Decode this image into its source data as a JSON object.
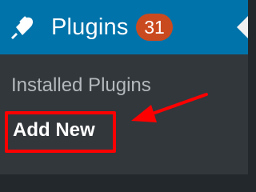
{
  "menu": {
    "icon": "plug-icon",
    "title": "Plugins",
    "badge": "31",
    "current_indicator": "current-menu-arrow"
  },
  "submenu": {
    "items": [
      {
        "label": "Installed Plugins",
        "active": false
      },
      {
        "label": "Add New",
        "active": true
      }
    ]
  },
  "annotation": {
    "highlight_color": "#ff0000",
    "arrow_icon": "arrow-pointer-icon"
  },
  "colors": {
    "header_bg": "#0073aa",
    "submenu_bg": "#32373c",
    "badge_bg": "#ca4a1f",
    "inactive_text": "#b4b9be",
    "active_text": "#ffffff"
  }
}
